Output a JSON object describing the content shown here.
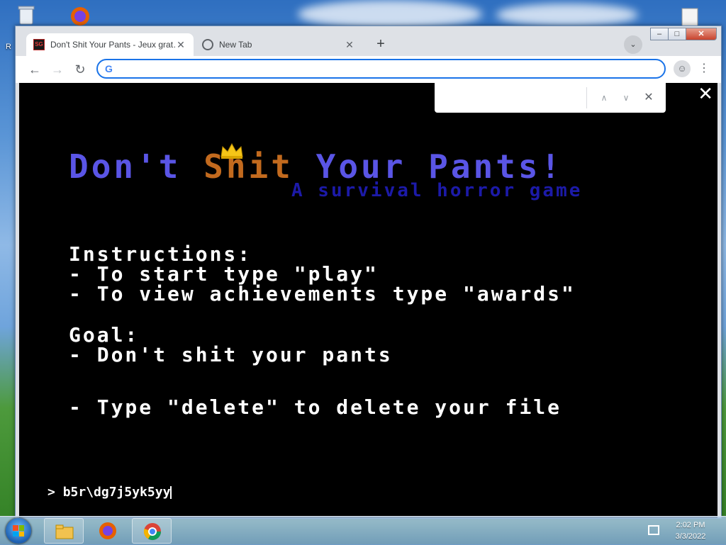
{
  "desktop": {
    "recycle_bin_label": "R"
  },
  "browser": {
    "tabs": [
      {
        "title": "Don't Shit Your Pants - Jeux grat…",
        "favicon": "sg-favicon",
        "active": true
      },
      {
        "title": "New Tab",
        "favicon": "globe-icon",
        "active": false
      }
    ],
    "new_tab_label": "+",
    "tab_search_label": "⌄",
    "window_controls": {
      "minimize": "–",
      "maximize": "□",
      "close": "✕"
    },
    "toolbar": {
      "back": "←",
      "forward": "→",
      "reload": "↻",
      "omnibox_value": "",
      "omnibox_icon": "G",
      "profile": "☺",
      "menu": "⋮"
    },
    "find_bar": {
      "value": "",
      "prev": "∧",
      "next": "∨",
      "close": "✕"
    },
    "fullscreen_close": "✕"
  },
  "game": {
    "title_part1": "Don't ",
    "title_part2": "Shit",
    "title_part3": " Your Pants!",
    "subtitle": "A survival horror game",
    "instructions_heading": "Instructions:",
    "instruction_1": "- To start type \"play\"",
    "instruction_2": "- To view achievements type \"awards\"",
    "goal_heading": "Goal:",
    "goal_1": "- Don't shit your pants",
    "delete_hint": "- Type \"delete\" to delete your file",
    "prompt_symbol": ">",
    "prompt_input": "b5r\\dg7j5yk5yy"
  },
  "taskbar": {
    "clock_time": "2:02 PM",
    "clock_date": "3/3/2022",
    "items": [
      "file-explorer-icon",
      "firefox-icon",
      "chrome-icon"
    ]
  },
  "colors": {
    "title_blue": "#5a55e6",
    "title_orange": "#c26a1e",
    "subtitle_blue": "#1c1aa8",
    "omnibox_focus": "#1a73e8"
  }
}
